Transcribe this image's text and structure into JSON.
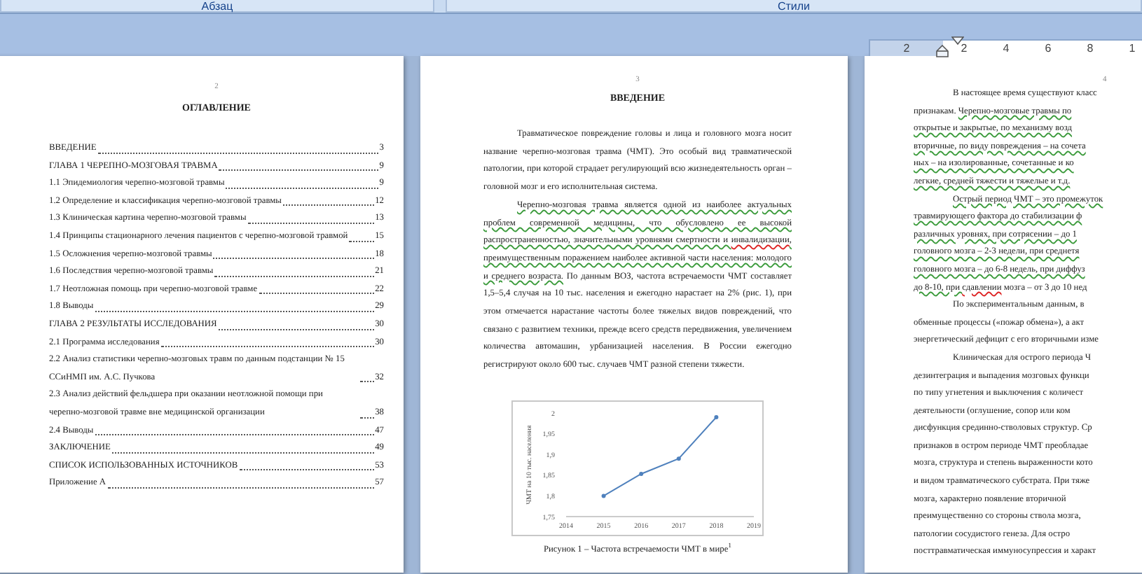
{
  "ribbon": {
    "groups": [
      "Абзац",
      "Стили"
    ]
  },
  "ruler": {
    "labels": [
      {
        "text": "2",
        "in_margin": true
      },
      {
        "text": "2",
        "in_margin": false
      },
      {
        "text": "4",
        "in_margin": false
      },
      {
        "text": "6",
        "in_margin": false
      },
      {
        "text": "8",
        "in_margin": false
      },
      {
        "text": "1",
        "in_margin": false
      }
    ]
  },
  "pages": [
    {
      "kind": "toc",
      "number": "2",
      "heading": "ОГЛАВЛЕНИЕ",
      "entries": [
        {
          "title": "ВВЕДЕНИЕ",
          "page": "3"
        },
        {
          "title": "ГЛАВА 1 ЧЕРЕПНО-МОЗГОВАЯ ТРАВМА",
          "page": "9"
        },
        {
          "title": "1.1 Эпидемиология черепно-мозговой травмы",
          "page": "9"
        },
        {
          "title": "1.2 Определение и классификация черепно-мозговой травмы",
          "page": "12"
        },
        {
          "title": "1.3 Клиническая картина черепно-мозговой травмы",
          "page": "13"
        },
        {
          "title": "1.4 Принципы стационарного лечения пациентов с черепно-мозговой травмой",
          "page": "15"
        },
        {
          "title": "1.5 Осложнения черепно-мозговой травмы",
          "page": "18"
        },
        {
          "title": "1.6 Последствия черепно-мозговой травмы",
          "page": "21"
        },
        {
          "title": "1.7 Неотложная помощь при черепно-мозговой травме",
          "page": "22"
        },
        {
          "title": "1.8 Выводы",
          "page": "29"
        },
        {
          "title": "ГЛАВА 2 РЕЗУЛЬТАТЫ ИССЛЕДОВАНИЯ",
          "page": "30"
        },
        {
          "title": "2.1 Программа исследования",
          "page": "30"
        },
        {
          "title": "2.2 Анализ статистики черепно-мозговых травм по данным подстанции № 15 ССиНМП им. А.С. Пучкова",
          "page": "32"
        },
        {
          "title": "2.3 Анализ действий фельдшера при оказании неотложной помощи при черепно-мозговой травме вне медицинской организации",
          "page": "38"
        },
        {
          "title": "2.4 Выводы",
          "page": "47"
        },
        {
          "title": "ЗАКЛЮЧЕНИЕ",
          "page": "49"
        },
        {
          "title": "СПИСОК ИСПОЛЬЗОВАННЫХ ИСТОЧНИКОВ",
          "page": "53"
        },
        {
          "title": "Приложение А",
          "page": "57"
        }
      ]
    },
    {
      "kind": "text",
      "number": "3",
      "heading": "ВВЕДЕНИЕ",
      "paragraphs": [
        [
          {
            "text": "Травматическое повреждение головы и лица и головного мозга носит название черепно-мозговая травма (ЧМТ). Это особый вид травматической патологии, при которой страдает регулирующий всю жизнедеятельность орган – головной мозг и его исполнительная система."
          }
        ],
        [
          {
            "text": "Черепно-мозговая травма является одной из наиболее актуальных проблем современной медицины, что обусловлено ее высокой распространенностью, значительными уровнями смертности и ",
            "grammar_flagged": true
          },
          {
            "text": "инвалидизации",
            "misspelled": true
          },
          {
            "text": ", преимущественным поражением наиболее активной части населения: молодого и среднего возраста.",
            "grammar_flagged": true
          },
          {
            "text": " По данным ВОЗ, частота встречаемости ЧМТ составляет 1,5–5,4 случая на 10 тыс. населения и ежегодно нарастает на 2% (рис. 1), при этом отмечается нарастание частоты более тяжелых видов повреждений, что связано с развитием техники, прежде всего средств передвижения, увеличением количества автомашин, урбанизацией населения. В России ежегодно регистрируют около 600 тыс. случаев ЧМТ разной степени тяжести."
          }
        ]
      ],
      "figure": {
        "caption": "Рисунок 1 – Частота встречаемости ЧМТ в мире$^{1}$",
        "chart_data": {
          "type": "line",
          "marker": "circle",
          "ylabel": "ЧМТ на 10 тыс. населения",
          "x": [
            2015,
            2016,
            2017,
            2018
          ],
          "values": [
            1.8,
            1.853,
            1.89,
            1.99
          ],
          "xlim": [
            2014,
            2019
          ],
          "ylim": [
            1.75,
            2
          ],
          "xticks": [
            2014,
            2015,
            2016,
            2017,
            2018,
            2019
          ],
          "yticks": [
            {
              "value": 1.75,
              "label": "1,75"
            },
            {
              "value": 1.8,
              "label": "1,8"
            },
            {
              "value": 1.85,
              "label": "1,85"
            },
            {
              "value": 1.9,
              "label": "1,9"
            },
            {
              "value": 1.95,
              "label": "1,95"
            },
            {
              "value": 2,
              "label": "2"
            }
          ]
        }
      }
    },
    {
      "kind": "lines",
      "number": "4",
      "lines": [
        {
          "indent": true,
          "segments": [
            {
              "text": "В настоящее время существуют класс"
            }
          ]
        },
        {
          "indent": false,
          "segments": [
            {
              "text": "признакам. "
            },
            {
              "text": "Черепно-мозговые травмы по",
              "grammar_flagged": true
            }
          ]
        },
        {
          "indent": false,
          "segments": [
            {
              "text": "открытые и закрытые, по механизму возд",
              "grammar_flagged": true
            }
          ]
        },
        {
          "indent": false,
          "segments": [
            {
              "text": "вторичные, по виду повреждения – на сочета",
              "grammar_flagged": true
            }
          ]
        },
        {
          "indent": false,
          "segments": [
            {
              "text": "ных – на изолированные, сочетанные и ко",
              "grammar_flagged": true
            }
          ]
        },
        {
          "indent": false,
          "segments": [
            {
              "text": "легкие, средней тяжести и тяжелые и т.д.",
              "grammar_flagged": true
            }
          ]
        },
        {
          "indent": true,
          "segments": [
            {
              "text": "Острый период ЧМТ – это промежуток",
              "grammar_flagged": true
            }
          ]
        },
        {
          "indent": false,
          "segments": [
            {
              "text": "травмирующего фактора до стабилизации ф",
              "grammar_flagged": true
            }
          ]
        },
        {
          "indent": false,
          "segments": [
            {
              "text": "различных уровнях, при сотрясении – до 1",
              "grammar_flagged": true
            }
          ]
        },
        {
          "indent": false,
          "segments": [
            {
              "text": "головного мозга – 2-3 недели, при среднетя",
              "grammar_flagged": true
            }
          ]
        },
        {
          "indent": false,
          "segments": [
            {
              "text": "головного мозга – до 6-8 недель, при диффуз",
              "grammar_flagged": true
            }
          ]
        },
        {
          "indent": false,
          "segments": [
            {
              "text": "до 8-10, при ",
              "grammar_flagged": true
            },
            {
              "text": "сдавлении",
              "misspelled": true
            },
            {
              "text": " мозга – от 3 до 10 нед"
            }
          ]
        },
        {
          "indent": true,
          "segments": [
            {
              "text": "По экспериментальным данным, в"
            }
          ]
        },
        {
          "indent": false,
          "segments": [
            {
              "text": "обменные процессы («пожар обмена»), а акт"
            }
          ]
        },
        {
          "indent": false,
          "segments": [
            {
              "text": "энергетический дефицит с его вторичными изме"
            }
          ]
        },
        {
          "indent": true,
          "segments": [
            {
              "text": "Клиническая для острого периода Ч"
            }
          ]
        },
        {
          "indent": false,
          "segments": [
            {
              "text": "дезинтеграция и выпадения мозговых функци"
            }
          ]
        },
        {
          "indent": false,
          "segments": [
            {
              "text": "по типу угнетения и выключения с количест"
            }
          ]
        },
        {
          "indent": false,
          "segments": [
            {
              "text": "деятельности (оглушение, сопор или ком"
            }
          ]
        },
        {
          "indent": false,
          "segments": [
            {
              "text": "дисфункция срединно-стволовых структур. Ср"
            }
          ]
        },
        {
          "indent": false,
          "segments": [
            {
              "text": "признаков в остром периоде ЧМТ преобладае"
            }
          ]
        },
        {
          "indent": false,
          "segments": [
            {
              "text": "мозга, структура и степень выраженности кото"
            }
          ]
        },
        {
          "indent": false,
          "segments": [
            {
              "text": "и видом травматического субстрата. При тяже"
            }
          ]
        },
        {
          "indent": false,
          "segments": [
            {
              "text": "мозга, характерно появление вторичной"
            }
          ]
        },
        {
          "indent": false,
          "segments": [
            {
              "text": "преимущественно со стороны ствола мозга,"
            }
          ]
        },
        {
          "indent": false,
          "segments": [
            {
              "text": "патологии сосудистого генеза. Для остро"
            }
          ]
        },
        {
          "indent": false,
          "segments": [
            {
              "text": "посттравматическая иммуносупрессия и характ"
            }
          ]
        }
      ]
    }
  ]
}
